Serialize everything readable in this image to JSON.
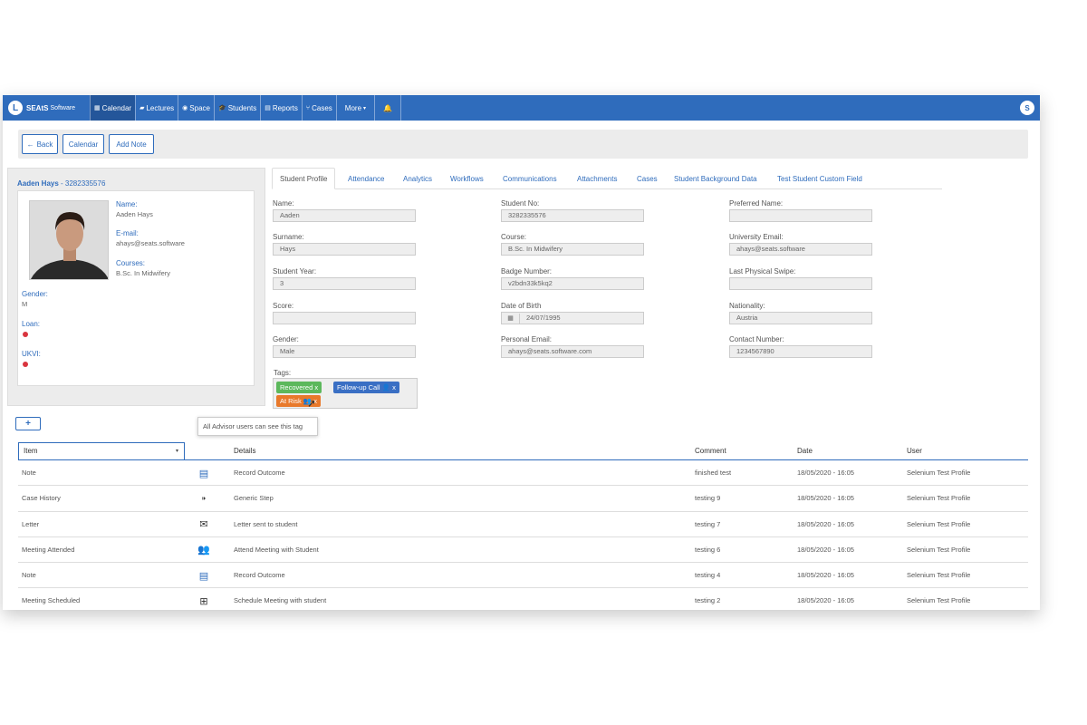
{
  "nav": {
    "brand_name": "SEAtS",
    "brand_sub": "Software",
    "items": [
      {
        "icon": "calendar-icon",
        "label": "Calendar"
      },
      {
        "icon": "lectures-icon",
        "label": "Lectures"
      },
      {
        "icon": "space-icon",
        "label": "Space"
      },
      {
        "icon": "students-icon",
        "label": "Students"
      },
      {
        "icon": "reports-icon",
        "label": "Reports"
      },
      {
        "icon": "cases-icon",
        "label": "Cases"
      },
      {
        "icon": "more-icon",
        "label": "More"
      }
    ],
    "user_initial": "S",
    "accent": "#2f6cbc"
  },
  "toolbar": {
    "back": "Back",
    "calendar": "Calendar",
    "add_note": "Add Note"
  },
  "student": {
    "title_name": "Aaden Hays",
    "title_id": "3282335576",
    "name_label": "Name:",
    "name": "Aaden Hays",
    "email_label": "E-mail:",
    "email": "ahays@seats.software",
    "courses_label": "Courses:",
    "course": "B.Sc. In Midwifery",
    "gender_label": "Gender:",
    "gender": "M",
    "loan_label": "Loan:",
    "ukvi_label": "UKVI:"
  },
  "tabs": [
    "Student Profile",
    "Attendance",
    "Analytics",
    "Workflows",
    "Communications",
    "Attachments",
    "Cases",
    "Student Background Data",
    "Test Student Custom Field"
  ],
  "fields": {
    "name_l": "Name:",
    "name_v": "Aaden",
    "surname_l": "Surname:",
    "surname_v": "Hays",
    "year_l": "Student Year:",
    "year_v": "3",
    "score_l": "Score:",
    "score_v": "",
    "gender_l": "Gender:",
    "gender_v": "Male",
    "studentno_l": "Student No:",
    "studentno_v": "3282335576",
    "course_l": "Course:",
    "course_v": "B.Sc. In Midwifery",
    "badge_l": "Badge Number:",
    "badge_v": "v2bdn33k5kq2",
    "dob_l": "Date of Birth",
    "dob_v": "24/07/1995",
    "pemail_l": "Personal Email:",
    "pemail_v": "ahays@seats.software.com",
    "pref_l": "Preferred Name:",
    "pref_v": "",
    "uemail_l": "University Email:",
    "uemail_v": "ahays@seats.software",
    "swipe_l": "Last Physical Swipe:",
    "swipe_v": "",
    "nat_l": "Nationality:",
    "nat_v": "Austria",
    "contact_l": "Contact Number:",
    "contact_v": "1234567890",
    "tags_l": "Tags:"
  },
  "tags": [
    {
      "label": "Recovered",
      "color": "#5cb85c"
    },
    {
      "label": "Follow-up Call",
      "color": "#3a6fc4"
    },
    {
      "label": "At Risk",
      "color": "#e8792b"
    }
  ],
  "tooltip": "All Advisor users can see this tag",
  "table": {
    "headers": {
      "item": "Item",
      "details": "Details",
      "comment": "Comment",
      "date": "Date",
      "user": "User"
    },
    "rows": [
      {
        "item": "Note",
        "icon": "note-icon",
        "details": "Record Outcome",
        "comment": "finished test",
        "date": "18/05/2020 - 16:05",
        "user": "Selenium Test Profile"
      },
      {
        "item": "Case History",
        "icon": "steps-icon",
        "details": "Generic Step",
        "comment": "testing 9",
        "date": "18/05/2020 - 16:05",
        "user": "Selenium Test Profile"
      },
      {
        "item": "Letter",
        "icon": "envelope-icon",
        "details": "Letter sent to student",
        "comment": "testing 7",
        "date": "18/05/2020 - 16:05",
        "user": "Selenium Test Profile"
      },
      {
        "item": "Meeting Attended",
        "icon": "group-icon",
        "details": "Attend Meeting with Student",
        "comment": "testing 6",
        "date": "18/05/2020 - 16:05",
        "user": "Selenium Test Profile"
      },
      {
        "item": "Note",
        "icon": "note-icon",
        "details": "Record Outcome",
        "comment": "testing 4",
        "date": "18/05/2020 - 16:05",
        "user": "Selenium Test Profile"
      },
      {
        "item": "Meeting Scheduled",
        "icon": "calendar-plus-icon",
        "details": "Schedule Meeting with student",
        "comment": "testing 2",
        "date": "18/05/2020 - 16:05",
        "user": "Selenium Test Profile"
      }
    ]
  }
}
